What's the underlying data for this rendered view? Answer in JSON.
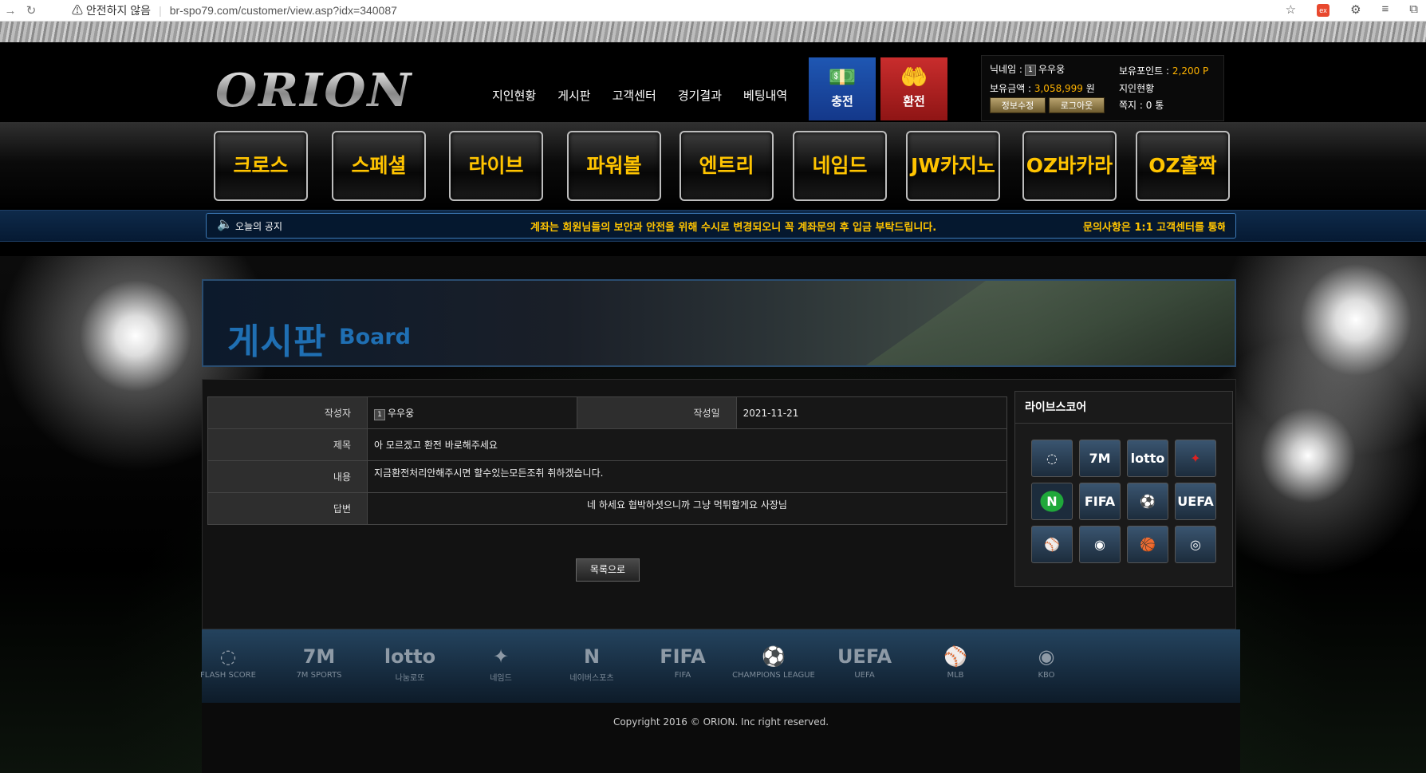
{
  "browser": {
    "warning": "안전하지 않음",
    "url": "br-spo79.com/customer/view.asp?idx=340087"
  },
  "header": {
    "logo": "ORION",
    "menu": [
      "지인현황",
      "게시판",
      "고객센터",
      "경기결과",
      "베팅내역"
    ],
    "charge_label": "충전",
    "exchange_label": "환전",
    "user": {
      "nickname_label": "닉네임 :",
      "level": "1",
      "nickname": "우우웅",
      "balance_label": "보유금액 :",
      "balance": "3,058,999",
      "balance_unit": "원",
      "points_label": "보유포인트 :",
      "points": "2,200 P",
      "friends": "지인현황",
      "messages": "쪽지 : 0 통",
      "edit_btn": "정보수정",
      "logout_btn": "로그아웃"
    }
  },
  "games": [
    "크로스",
    "스페셜",
    "라이브",
    "파워볼",
    "엔트리",
    "네임드",
    "JW카지노",
    "OZ바카라",
    "OZ홀짝"
  ],
  "notice": {
    "label": "오늘의 공지",
    "message": "계좌는 회원님들의 보안과 안전을 위해 수시로 변경되오니 꼭 계좌문의 후 입금 부탁드립니다.",
    "message2": "문의사항은 1:1 고객센터를 통해"
  },
  "board": {
    "title_ko": "게시판",
    "title_en": "Board"
  },
  "post": {
    "author_label": "작성자",
    "author_level": "1",
    "author": "우우웅",
    "date_label": "작성일",
    "date": "2021-11-21",
    "subject_label": "제목",
    "subject": "아 모르겠고 환전 바로해주세요",
    "content_label": "내용",
    "content": "지금환전처리안해주시면 할수있는모든조취 취하겠습니다.",
    "reply_label": "답변",
    "reply": "네 하세요 협박하셧으니까 그냥 먹튀할게요 사장님",
    "list_btn": "목록으로"
  },
  "livescore": {
    "title": "라이브스코어",
    "icons": [
      "flash-score-icon",
      "7m-icon",
      "lotto-icon",
      "named-icon",
      "naver-icon",
      "fifa-icon",
      "champions-icon",
      "uefa-icon",
      "mlb-icon",
      "kbo-icon",
      "nba-icon",
      "nhl-icon"
    ],
    "glyphs": [
      "◌",
      "7M",
      "lotto",
      "✦",
      "N",
      "FIFA",
      "⚽",
      "UEFA",
      "⚾",
      "◉",
      "🏀",
      "◎"
    ]
  },
  "footer": {
    "items": [
      "FLASH SCORE",
      "7M SPORTS",
      "나눔로또",
      "네임드",
      "네이버스포츠",
      "FIFA",
      "CHAMPIONS LEAGUE",
      "UEFA",
      "MLB",
      "KBO"
    ],
    "glyphs": [
      "◌",
      "7M",
      "lotto",
      "✦",
      "N",
      "FIFA",
      "⚽",
      "UEFA",
      "⚾",
      "◉"
    ],
    "copyright": "Copyright 2016 © ORION. Inc right reserved."
  }
}
